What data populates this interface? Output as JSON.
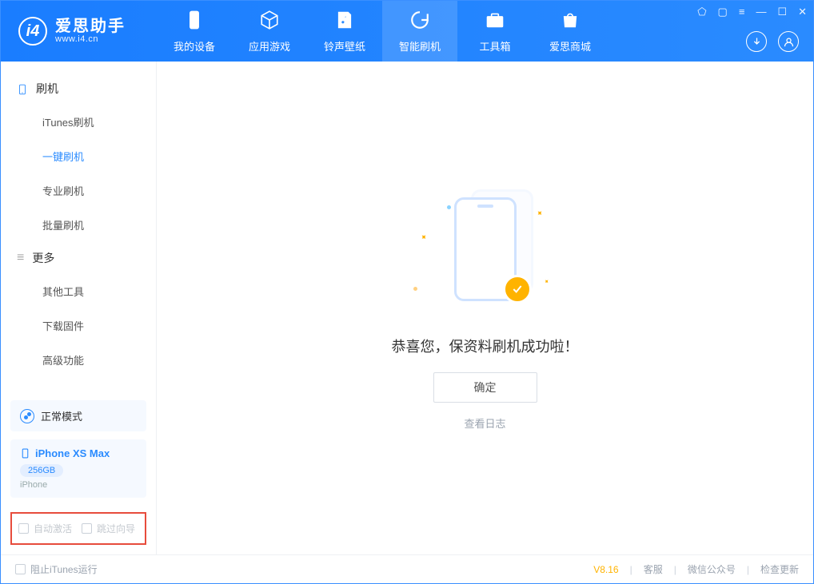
{
  "app": {
    "title": "爱思助手",
    "subtitle": "www.i4.cn"
  },
  "tabs": {
    "device": "我的设备",
    "apps": "应用游戏",
    "ringtone": "铃声壁纸",
    "flash": "智能刷机",
    "toolbox": "工具箱",
    "store": "爱思商城"
  },
  "sidebar": {
    "section1": "刷机",
    "itunes": "iTunes刷机",
    "oneclick": "一键刷机",
    "pro": "专业刷机",
    "batch": "批量刷机",
    "section2": "更多",
    "other": "其他工具",
    "download": "下载固件",
    "advanced": "高级功能"
  },
  "device": {
    "mode": "正常模式",
    "name": "iPhone XS Max",
    "storage": "256GB",
    "type": "iPhone"
  },
  "options": {
    "autoactivate": "自动激活",
    "skipwizard": "跳过向导"
  },
  "main": {
    "success": "恭喜您，保资料刷机成功啦！",
    "ok": "确定",
    "viewlog": "查看日志"
  },
  "status": {
    "blockitunes": "阻止iTunes运行",
    "version": "V8.16",
    "support": "客服",
    "wechat": "微信公众号",
    "update": "检查更新"
  }
}
